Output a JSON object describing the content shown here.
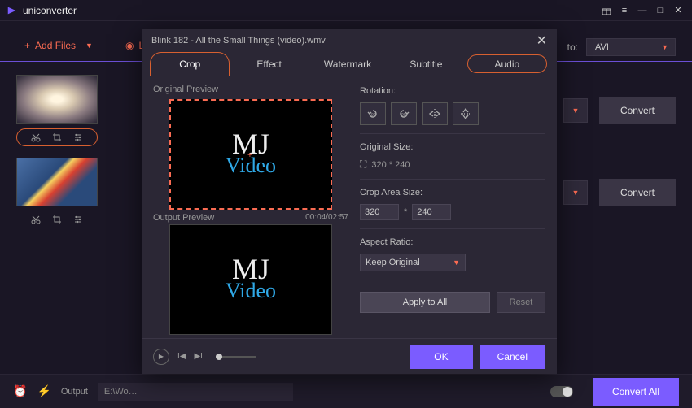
{
  "app": {
    "name": "uniconverter"
  },
  "toolbar": {
    "add_files": "Add Files",
    "load_dvd": "Load",
    "convert_to_label": "to:",
    "target_format": "AVI"
  },
  "files": [
    {
      "convert_label": "Convert",
      "edit_highlighted": true
    },
    {
      "convert_label": "Convert",
      "edit_highlighted": false
    }
  ],
  "bottom": {
    "output_label": "Output",
    "output_path": "E:\\Wo…",
    "convert_all": "Convert All"
  },
  "modal": {
    "title": "Blink 182 - All the Small Things (video).wmv",
    "tabs": {
      "crop": "Crop",
      "effect": "Effect",
      "watermark": "Watermark",
      "subtitle": "Subtitle",
      "audio": "Audio"
    },
    "preview": {
      "original_label": "Original Preview",
      "output_label": "Output Preview",
      "timecode": "00:04/02:57"
    },
    "settings": {
      "rotation_label": "Rotation:",
      "original_size_label": "Original Size:",
      "original_size_value": "320 * 240",
      "crop_area_label": "Crop Area Size:",
      "crop_w": "320",
      "crop_star": "*",
      "crop_h": "240",
      "aspect_label": "Aspect Ratio:",
      "aspect_value": "Keep Original",
      "apply_all": "Apply to All",
      "reset": "Reset"
    },
    "footer": {
      "ok": "OK",
      "cancel": "Cancel"
    }
  }
}
